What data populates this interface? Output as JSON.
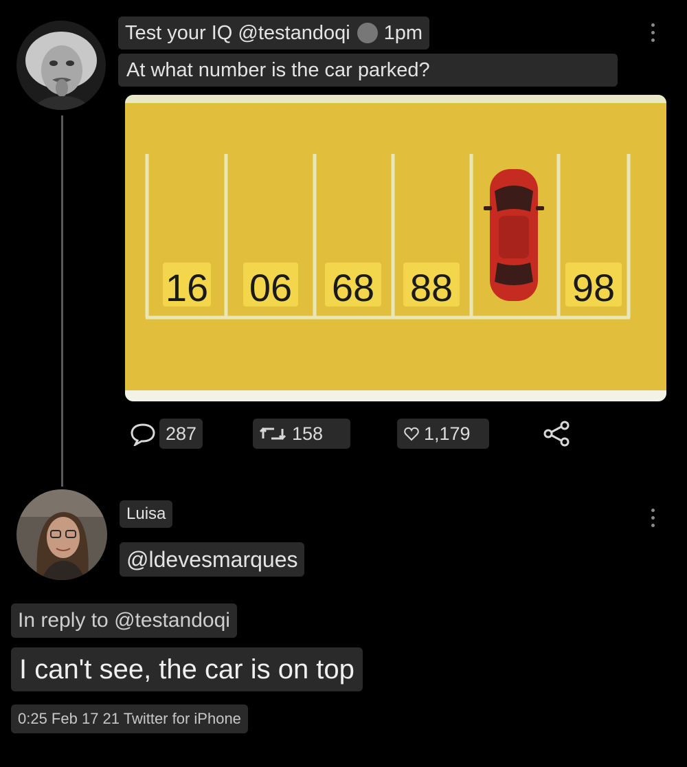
{
  "tweet": {
    "title": "Test your IQ @testandoqi",
    "time": "1pm",
    "question": "At what number is the car parked?",
    "image": {
      "spot_numbers": [
        "16",
        "06",
        "68",
        "88",
        "98"
      ],
      "car_color": "#c62b22",
      "background_color": "#e1be3c"
    },
    "stats": {
      "comments": "287",
      "retweets": "158",
      "likes": "1,179"
    }
  },
  "reply": {
    "name": "Luisa",
    "handle": "@ldevesmarques",
    "in_reply_to": "In reply to @testandoqi",
    "text": "I can't see, the car is on top",
    "meta": "0:25 Feb 17 21 Twitter for iPhone"
  },
  "icons": [
    "comment-icon",
    "retweet-icon",
    "heart-icon",
    "share-icon",
    "more-options-icon"
  ]
}
